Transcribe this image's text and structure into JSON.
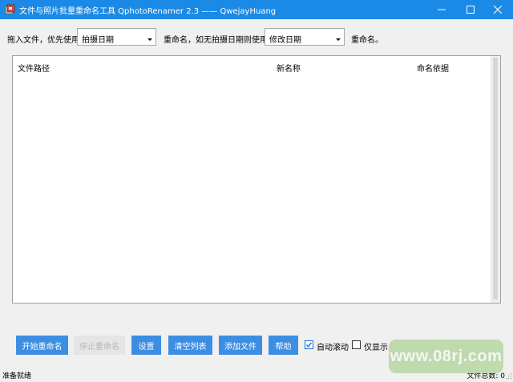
{
  "window": {
    "title": "文件与照片批量重命名工具 QphotoRenamer 2.3 —— QwejayHuang",
    "minimize_icon": "minimize-icon",
    "maximize_icon": "maximize-icon",
    "close_icon": "close-icon"
  },
  "options": {
    "drag_label": "拖入文件，优先使用",
    "primary_select": "拍摄日期",
    "middle_label": "重命名，如无拍摄日期则使用",
    "fallback_select": "修改日期",
    "end_label": "重命名。"
  },
  "table": {
    "columns": [
      "文件路径",
      "新名称",
      "命名依据"
    ],
    "rows": []
  },
  "buttons": {
    "start": "开始重命名",
    "stop": "停止重命名",
    "settings": "设置",
    "clear": "清空列表",
    "add": "添加文件",
    "help": "帮助"
  },
  "checkboxes": {
    "auto_scroll": {
      "label": "自动滚动",
      "checked": true
    },
    "show_only": {
      "label": "仅显示",
      "checked": false
    }
  },
  "status": {
    "left": "准备就绪",
    "right": "文件总数: 0"
  },
  "watermark": "www.08rj.com",
  "colors": {
    "titlebar": "#1b8ae6",
    "button": "#3c8ee2",
    "button_disabled": "#e5e5e5"
  }
}
